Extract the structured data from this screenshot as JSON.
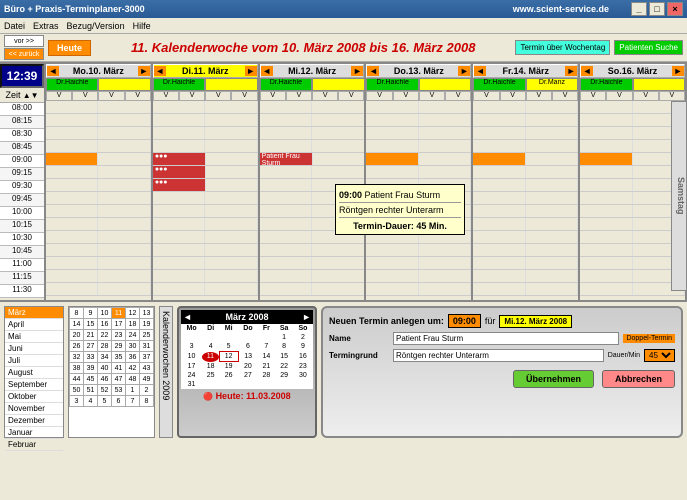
{
  "title": "Büro + Praxis-Terminplaner-3000",
  "url": "www.scient-service.de",
  "menu": [
    "Datei",
    "Extras",
    "Bezug/Version",
    "Hilfe"
  ],
  "nav": {
    "vor": "vor >>",
    "zurueck": "<< zurück",
    "heute": "Heute"
  },
  "weektitle": "11. Kalenderwoche vom 10. März 2008 bis 16. März 2008",
  "rbtns": {
    "termin": "Termin über Wochentag",
    "patient": "Patienten Suche"
  },
  "clock": "12:39",
  "zeit": "Zeit",
  "days": [
    "Mo.10. März",
    "Di.11. März",
    "Mi.12. März",
    "Do.13. März",
    "Fr.14. März",
    "So.16. März"
  ],
  "todayIdx": 1,
  "staff": [
    "Dr.Haichle",
    "Dr.Manz"
  ],
  "times": [
    "08:00",
    "08:15",
    "08:30",
    "08:45",
    "09:00",
    "09:15",
    "09:30",
    "09:45",
    "10:00",
    "10:15",
    "10:30",
    "10:45",
    "11:00",
    "11:15",
    "11:30"
  ],
  "samstag": "Samstag",
  "appt": {
    "label": "Patient Frau Sturm"
  },
  "tooltip": {
    "time": "09:00",
    "name": "Patient Frau Sturm",
    "reason": "Röntgen rechter Unterarm",
    "dur": "Termin-Dauer: 45 Min."
  },
  "months": [
    "März",
    "April",
    "Mai",
    "Juni",
    "Juli",
    "August",
    "September",
    "Oktober",
    "November",
    "Dezember",
    "Januar",
    "Februar"
  ],
  "weekgrid": [
    [
      "8",
      "9",
      "10",
      "11",
      "12",
      "13"
    ],
    [
      "14",
      "15",
      "16",
      "17",
      "18",
      "19"
    ],
    [
      "20",
      "21",
      "22",
      "23",
      "24",
      "25"
    ],
    [
      "26",
      "27",
      "28",
      "29",
      "30",
      "31"
    ],
    [
      "32",
      "33",
      "34",
      "35",
      "36",
      "37"
    ],
    [
      "38",
      "39",
      "40",
      "41",
      "42",
      "43"
    ],
    [
      "44",
      "45",
      "46",
      "47",
      "48",
      "49"
    ],
    [
      "50",
      "51",
      "52",
      "53",
      "1",
      "2"
    ],
    [
      "3",
      "4",
      "5",
      "6",
      "7",
      "8"
    ]
  ],
  "kw": "Kalenderwochen",
  "year": "2009",
  "cal": {
    "title": "März 2008",
    "dow": [
      "Mo",
      "Di",
      "Mi",
      "Do",
      "Fr",
      "Sa",
      "So"
    ],
    "weeks": [
      [
        "",
        "",
        "",
        "",
        "",
        "1",
        "2"
      ],
      [
        "3",
        "4",
        "5",
        "6",
        "7",
        "8",
        "9"
      ],
      [
        "10",
        "11",
        "12",
        "13",
        "14",
        "15",
        "16"
      ],
      [
        "17",
        "18",
        "19",
        "20",
        "21",
        "22",
        "23"
      ],
      [
        "24",
        "25",
        "26",
        "27",
        "28",
        "29",
        "30"
      ],
      [
        "31",
        "",
        "",
        "",
        "",
        "",
        ""
      ]
    ],
    "footer": "Heute: 11.03.2008"
  },
  "form": {
    "title": "Neuen Termin anlegen um:",
    "time": "09:00",
    "fuer": "für",
    "day": "Mi.12. März 2008",
    "namelabel": "Name",
    "name": "Patient Frau Sturm",
    "doppel": "Doppel-Termin",
    "grundlabel": "Termingrund",
    "grund": "Röntgen rechter Unterarm",
    "dauerlabel": "Dauer/Min",
    "dauer": "45",
    "ok": "Übernehmen",
    "cancel": "Abbrechen"
  }
}
